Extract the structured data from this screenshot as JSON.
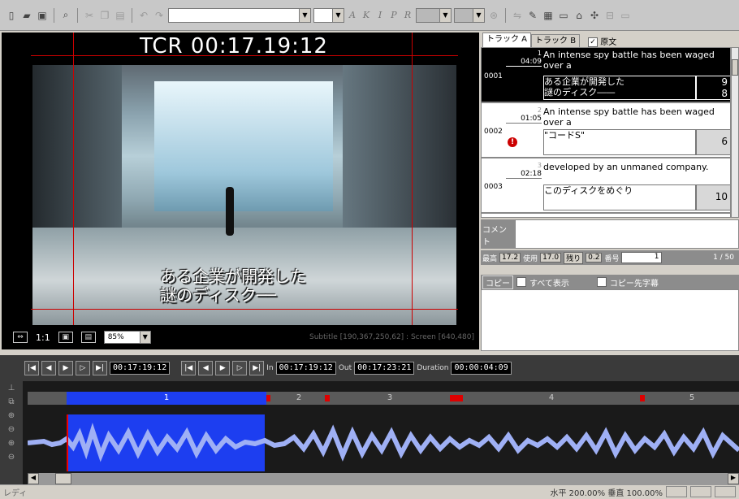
{
  "toolbar": {
    "icons": [
      "new-file",
      "open-folder",
      "save",
      "search",
      "cut",
      "copy",
      "paste",
      "undo",
      "redo"
    ],
    "font_combo": "",
    "letters": [
      "A",
      "K",
      "I",
      "P",
      "R"
    ]
  },
  "video": {
    "tcr_label": "TCR 00:17.19:12",
    "subtitle_line1": "ある企業が開発した",
    "subtitle_line2": "謎のディスク──",
    "ratio_label": "1:1",
    "zoom": "85%",
    "info": "Subtitle [190,367,250,62] : Screen [640,480]"
  },
  "tracks": {
    "tab_a": "トラック A",
    "tab_b": "トラック B",
    "original_label": "原文",
    "rows": [
      {
        "id": "0001",
        "idx": "1",
        "tc": "04:09",
        "en": "An intense spy battle has been waged over a",
        "ja": "ある企業が開発した\n謎のディスク――",
        "num": "9\n8"
      },
      {
        "id": "0002",
        "idx": "2",
        "tc": "01:05",
        "en": "An intense spy battle has been waged over a",
        "ja": "\"コードS\"",
        "num": "6"
      },
      {
        "id": "0003",
        "idx": "3",
        "tc": "02:18",
        "en": "developed by an unmaned company.",
        "ja": "このディスクをめぐり",
        "num": "10"
      }
    ]
  },
  "comment": {
    "label": "コメント"
  },
  "stats": {
    "max_label": "最高",
    "max_val": "17.2",
    "used_label": "使用",
    "used_val": "17.0",
    "rest_label": "残り",
    "rest_val": "0.2",
    "num_label": "番号",
    "num_val": "1",
    "page": "1 / 50"
  },
  "copy": {
    "label": "コピー",
    "show_all": "すべて表示",
    "dest": "コピー先字幕"
  },
  "transport": {
    "current_tc": "00:17:19:12",
    "in_label": "In",
    "in_tc": "00:17:19:12",
    "out_label": "Out",
    "out_tc": "00:17:23:21",
    "duration_label": "Duration",
    "duration_tc": "00:00:04:09"
  },
  "timeline": {
    "segments": [
      "1",
      "2",
      "3",
      "4",
      "5"
    ]
  },
  "status": {
    "ready": "レディ",
    "scale": "水平 200.00% 垂直 100.00%"
  }
}
